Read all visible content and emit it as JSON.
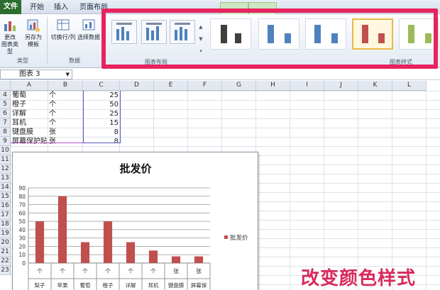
{
  "ribbon_tabs": [
    {
      "label": "文件",
      "left": 0
    },
    {
      "label": "开始",
      "left": 44
    },
    {
      "label": "插入",
      "left": 78
    },
    {
      "label": "页面布局",
      "left": 118
    }
  ],
  "ribbon_tabs_ctx": [
    {
      "label": "",
      "left": 314
    },
    {
      "label": "",
      "left": 346
    }
  ],
  "ribbon": {
    "change_type": "更改\n图表类型",
    "save_template": "另存为\n模板",
    "group_type": "类型",
    "switch_rowcol": "切换行/列",
    "select_data": "选择数据",
    "group_data": "数据",
    "group_layout": "图表布局",
    "group_styles": "图表样式"
  },
  "namebox": {
    "value": "图表 3"
  },
  "columns": [
    "A",
    "B",
    "C",
    "D",
    "E",
    "F",
    "G",
    "H",
    "I",
    "J",
    "K",
    "L"
  ],
  "rows": [
    "4",
    "5",
    "6",
    "7",
    "8",
    "9",
    "10",
    "11",
    "12",
    "13",
    "14",
    "15",
    "16",
    "17",
    "18",
    "19",
    "20",
    "21",
    "22",
    "23"
  ],
  "table": [
    {
      "name": "葡萄",
      "unit": "个",
      "value": "25"
    },
    {
      "name": "橙子",
      "unit": "个",
      "value": "50"
    },
    {
      "name": "详解",
      "unit": "个",
      "value": "25"
    },
    {
      "name": "耳机",
      "unit": "个",
      "value": "15"
    },
    {
      "name": "键盘膜",
      "unit": "张",
      "value": "8"
    },
    {
      "name": "屏幕保护贴",
      "unit": "张",
      "value": "8"
    }
  ],
  "chart_data": {
    "type": "bar",
    "title": "批发价",
    "categories": [
      "梨子",
      "苹果",
      "葡萄",
      "橙子",
      "详解",
      "耳机",
      "键盘膜",
      "屏幕保"
    ],
    "category_units": [
      "个",
      "个",
      "个",
      "个",
      "个",
      "个",
      "张",
      "张"
    ],
    "series": [
      {
        "name": "批发价",
        "values": [
          50,
          80,
          25,
          50,
          25,
          15,
          8,
          8
        ],
        "color": "#c0504d"
      }
    ],
    "ylim": [
      0,
      90
    ],
    "yticks": [
      0,
      10,
      20,
      30,
      40,
      50,
      60,
      70,
      80,
      90
    ],
    "grid": true,
    "legend": "right"
  },
  "caption": "改变颜色样式",
  "colors": {
    "accent": "#e6245e",
    "file_tab": "#2c6e2f",
    "bar": "#c0504d"
  }
}
